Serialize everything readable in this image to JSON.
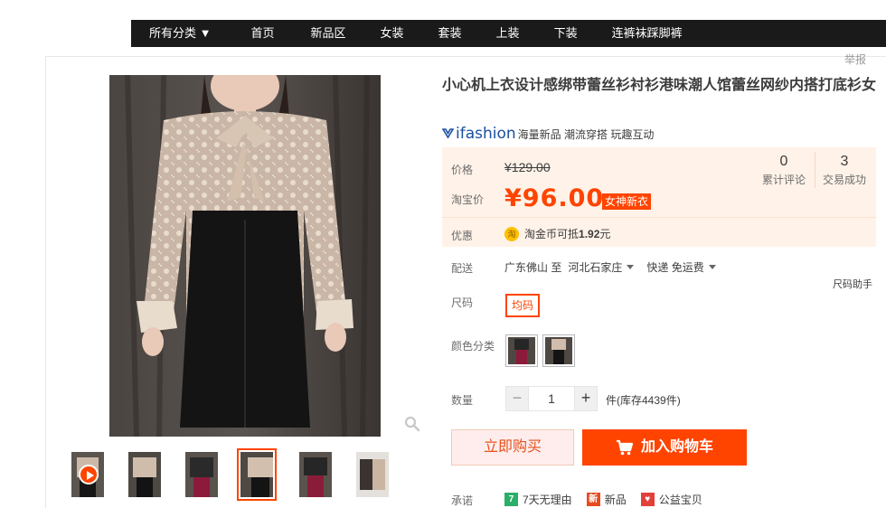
{
  "nav": {
    "items": [
      "所有分类 ▼",
      "首页",
      "新品区",
      "女装",
      "套装",
      "上装",
      "下装",
      "连裤袜踩脚裤"
    ]
  },
  "report_label": "举报",
  "product": {
    "title": "小心机上衣设计感绑带蕾丝衫衬衫港味潮人馆蕾丝网纱内搭打底衫女",
    "brand": "ifashion",
    "brand_tags": "海量新品 潮流穿搭 玩趣互动"
  },
  "price": {
    "label_price": "价格",
    "original": "¥129.00",
    "label_taobao": "淘宝价",
    "sale": "¥96.00",
    "sale_badge": "女神新衣",
    "stats": [
      {
        "num": "0",
        "caption": "累计评论"
      },
      {
        "num": "3",
        "caption": "交易成功"
      }
    ],
    "label_discount": "优惠",
    "coin_icon_text": "淘",
    "coupon_text": "淘金币可抵",
    "coupon_amount": "1.92",
    "coupon_unit": "元"
  },
  "delivery": {
    "label": "配送",
    "from": "广东佛山 至",
    "to": "河北石家庄",
    "method": "快递 免运费"
  },
  "size": {
    "helper": "尺码助手",
    "label": "尺码",
    "options": [
      "均码"
    ]
  },
  "color": {
    "label": "颜色分类"
  },
  "quantity": {
    "label": "数量",
    "value": "1",
    "minus": "−",
    "plus": "+",
    "stock_text": "件(库存4439件)"
  },
  "actions": {
    "buy_now": "立即购买",
    "add_to_cart": "加入购物车"
  },
  "promise": {
    "label": "承诺",
    "items": [
      {
        "icon_text": "7",
        "text": "7天无理由",
        "color": "#2aaf6a"
      },
      {
        "icon_text": "新",
        "text": "新品",
        "color": "#e84a1f"
      },
      {
        "icon_text": "♥",
        "text": "公益宝贝",
        "color": "#e2413a"
      }
    ]
  },
  "colors": {
    "accent": "#ff4400",
    "price_bg": "#fff2e8"
  }
}
